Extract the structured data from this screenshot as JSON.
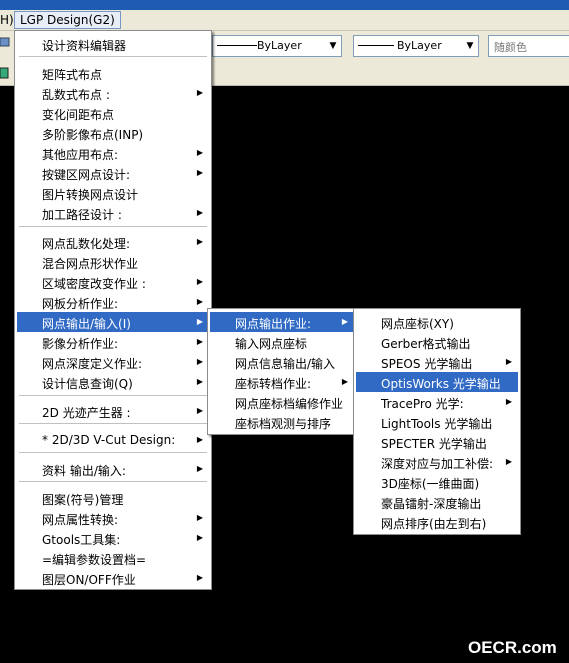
{
  "menubar": {
    "prev_item": "H)",
    "active_menu": "LGP Design(G2)"
  },
  "toolbar": {
    "linetype_combo": "ByLayer",
    "lineweight_combo": "ByLayer",
    "color_combo": "随颜色"
  },
  "main_menu": {
    "items": [
      {
        "label": "设计资料编辑器",
        "submenu": false
      },
      {
        "label": "矩阵式布点",
        "submenu": false
      },
      {
        "label": "乱数式布点 :",
        "submenu": true
      },
      {
        "label": "变化间距布点",
        "submenu": false
      },
      {
        "label": "多阶影像布点(INP)",
        "submenu": false
      },
      {
        "label": "其他应用布点:",
        "submenu": true
      },
      {
        "label": "按键区网点设计:",
        "submenu": true
      },
      {
        "label": "图片转换网点设计",
        "submenu": false
      },
      {
        "label": "加工路径设计 :",
        "submenu": true
      },
      {
        "label": "网点乱数化处理:",
        "submenu": true
      },
      {
        "label": "混合网点形状作业",
        "submenu": false
      },
      {
        "label": "区域密度改变作业 :",
        "submenu": true
      },
      {
        "label": "网板分析作业:",
        "submenu": true
      },
      {
        "label": "网点输出/输入(I)",
        "submenu": true
      },
      {
        "label": "影像分析作业:",
        "submenu": true
      },
      {
        "label": "网点深度定义作业:",
        "submenu": true
      },
      {
        "label": "设计信息查询(Q)",
        "submenu": true
      },
      {
        "label": "2D 光迹产生器 :",
        "submenu": true
      },
      {
        "label": "* 2D/3D V-Cut Design:",
        "submenu": true
      },
      {
        "label": "资料 输出/输入:",
        "submenu": true
      },
      {
        "label": "图案(符号)管理",
        "submenu": false
      },
      {
        "label": "网点属性转换:",
        "submenu": true
      },
      {
        "label": "Gtools工具集:",
        "submenu": true
      },
      {
        "label": "=编辑参数设置档=",
        "submenu": false
      },
      {
        "label": "图层ON/OFF作业",
        "submenu": true
      }
    ]
  },
  "submenu_io": {
    "items": [
      {
        "label": "网点输出作业:",
        "submenu": true
      },
      {
        "label": "输入网点座标",
        "submenu": false
      },
      {
        "label": "网点信息输出/输入",
        "submenu": false
      },
      {
        "label": "座标转档作业:",
        "submenu": true
      },
      {
        "label": "网点座标档编修作业",
        "submenu": false
      },
      {
        "label": "座标档观测与排序",
        "submenu": false
      }
    ]
  },
  "submenu_output": {
    "items": [
      {
        "label": "网点座标(XY)",
        "submenu": false
      },
      {
        "label": "Gerber格式输出",
        "submenu": false
      },
      {
        "label": "SPEOS  光学输出",
        "submenu": true
      },
      {
        "label": "OptisWorks 光学输出",
        "submenu": false
      },
      {
        "label": "TracePro 光学:",
        "submenu": true
      },
      {
        "label": "LightTools 光学输出",
        "submenu": false
      },
      {
        "label": "SPECTER 光学输出",
        "submenu": false
      },
      {
        "label": "深度对应与加工补偿:",
        "submenu": true
      },
      {
        "label": "3D座标(一维曲面)",
        "submenu": false
      },
      {
        "label": "豪晶镭射-深度输出",
        "submenu": false
      },
      {
        "label": "网点排序(由左到右)",
        "submenu": false
      }
    ]
  },
  "watermark": "OECR.com",
  "colors": {
    "highlight": "#316ac5",
    "menu_bg": "#ffffff",
    "toolbar_bg": "#ece9d8",
    "canvas": "#000000"
  }
}
